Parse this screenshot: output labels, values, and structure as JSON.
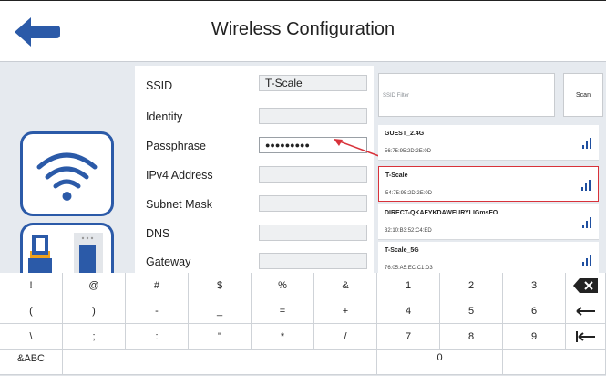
{
  "header": {
    "title": "Wireless Configuration",
    "back_icon": "back-arrow-icon"
  },
  "form": {
    "ssid": {
      "label": "SSID",
      "value": "T-Scale"
    },
    "identity": {
      "label": "Identity",
      "value": ""
    },
    "passphrase": {
      "label": "Passphrase",
      "value": "●●●●●●●●●"
    },
    "ipv4": {
      "label": "IPv4 Address",
      "value": ""
    },
    "subnet": {
      "label": "Subnet Mask",
      "value": ""
    },
    "dns": {
      "label": "DNS",
      "value": ""
    },
    "gateway": {
      "label": "Gateway",
      "value": ""
    }
  },
  "networks": {
    "filter_placeholder": "SSID Filter",
    "scan_label": "Scan",
    "items": [
      {
        "name": "GUEST_2.4G",
        "mac": "56:75:95:2D:2E:0D",
        "selected": false
      },
      {
        "name": "T-Scale",
        "mac": "54:75:95:2D:2E:0D",
        "selected": true
      },
      {
        "name": "DIRECT-QKAFYKDAWFURYLIGmsFO",
        "mac": "32:10:B3:52:C4:ED",
        "selected": false
      },
      {
        "name": "T-Scale_5G",
        "mac": "76:05:A5:EC:C1:D3",
        "selected": false
      }
    ]
  },
  "keyboard": {
    "row1": [
      "!",
      "@",
      "#",
      "$",
      "%",
      "&",
      "1",
      "2",
      "3"
    ],
    "row2": [
      "(",
      ")",
      "-",
      "_",
      "=",
      "+",
      "4",
      "5",
      "6"
    ],
    "row3": [
      "\\",
      ";",
      ":",
      "\"",
      "*",
      "/",
      "7",
      "8",
      "9"
    ],
    "row4": [
      "&ABC",
      "",
      "",
      "",
      "",
      "",
      "",
      "0",
      "",
      ""
    ],
    "icons": {
      "backspace": "backspace-icon",
      "enter": "enter-arrow-icon",
      "tab": "tab-icon"
    }
  },
  "colors": {
    "accent_blue": "#2b5aa8",
    "highlight_red": "#d8323a",
    "signal_blue": "#1f4fa0"
  }
}
